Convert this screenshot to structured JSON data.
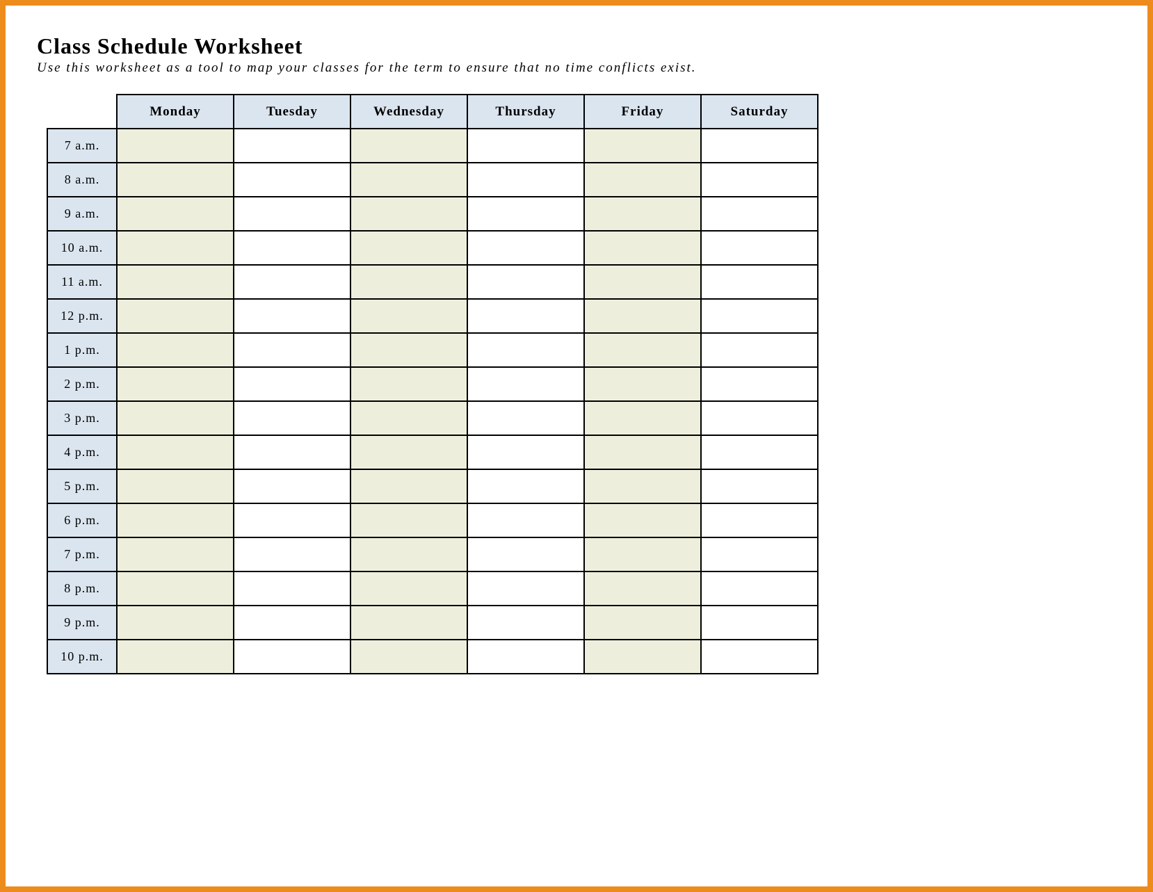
{
  "title": "Class Schedule Worksheet",
  "subtitle": "Use this worksheet as a tool to map your classes for the term to ensure that no time conflicts exist.",
  "days": [
    "Monday",
    "Tuesday",
    "Wednesday",
    "Thursday",
    "Friday",
    "Saturday"
  ],
  "times": [
    "7 a.m.",
    "8 a.m.",
    "9 a.m.",
    "10 a.m.",
    "11 a.m.",
    "12 p.m.",
    "1 p.m.",
    "2 p.m.",
    "3 p.m.",
    "4 p.m.",
    "5 p.m.",
    "6 p.m.",
    "7 p.m.",
    "8 p.m.",
    "9 p.m.",
    "10 p.m."
  ]
}
